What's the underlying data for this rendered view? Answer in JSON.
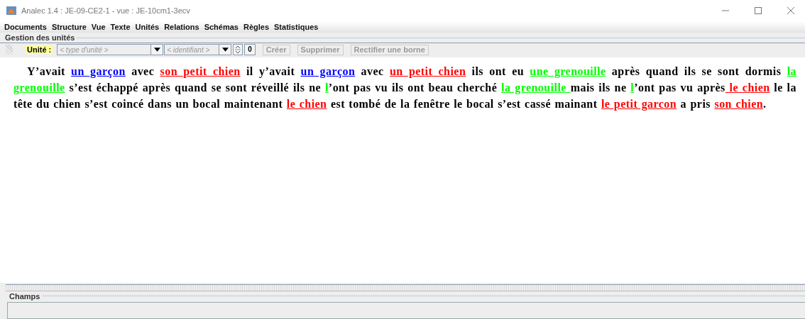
{
  "window": {
    "title": "Analec 1.4 : JE-09-CE2-1 - vue : JE-10cm1-3ecv"
  },
  "menu": [
    "Documents",
    "Structure",
    "Vue",
    "Texte",
    "Unités",
    "Relations",
    "Schémas",
    "Règles",
    "Statistiques"
  ],
  "units_panel": {
    "title": "Gestion des unités",
    "label": "Unité :",
    "type_placeholder": "< type d'unité >",
    "id_placeholder": "< identifiant >",
    "count": "0",
    "buttons": [
      {
        "label": "Créer",
        "disabled": true
      },
      {
        "label": "Supprimer",
        "disabled": true
      },
      {
        "label": "Rectifier une borne",
        "disabled": true
      }
    ]
  },
  "text": [
    {
      "t": "Y’avait "
    },
    {
      "t": "un garçon",
      "color": "#0000ff"
    },
    {
      "t": " avec "
    },
    {
      "t": "son petit chien",
      "color": "#ff0000"
    },
    {
      "t": " il y’avait "
    },
    {
      "t": "un garçon",
      "color": "#0000ff"
    },
    {
      "t": " avec "
    },
    {
      "t": "un petit chien",
      "color": "#ff0000"
    },
    {
      "t": " ils ont eu "
    },
    {
      "t": "une grenouille",
      "color": "#00ff00"
    },
    {
      "t": " après quand ils se sont dormis "
    },
    {
      "t": "la grenouille",
      "color": "#00ff00"
    },
    {
      "t": " s’est échappé après quand se sont réveillé ils ne "
    },
    {
      "t": "l",
      "color": "#00ff00"
    },
    {
      "t": "’ont pas vu ils ont beau cherché "
    },
    {
      "t": "la grenouille ",
      "color": "#00ff00"
    },
    {
      "t": "mais ils ne "
    },
    {
      "t": "l",
      "color": "#00ff00"
    },
    {
      "t": "’ont pas vu après"
    },
    {
      "t": " le chien",
      "color": "#ff0000"
    },
    {
      "t": " le la tête du chien s’est coincé dans un bocal maintenant "
    },
    {
      "t": "le chien",
      "color": "#ff0000"
    },
    {
      "t": " est tombé de la fenêtre le bocal s’est cassé mainant "
    },
    {
      "t": "le petit garcon",
      "color": "#ff0000"
    },
    {
      "t": " a pris "
    },
    {
      "t": "son chien",
      "color": "#ff0000"
    },
    {
      "t": "."
    }
  ],
  "fields_panel": {
    "title": "Champs"
  }
}
